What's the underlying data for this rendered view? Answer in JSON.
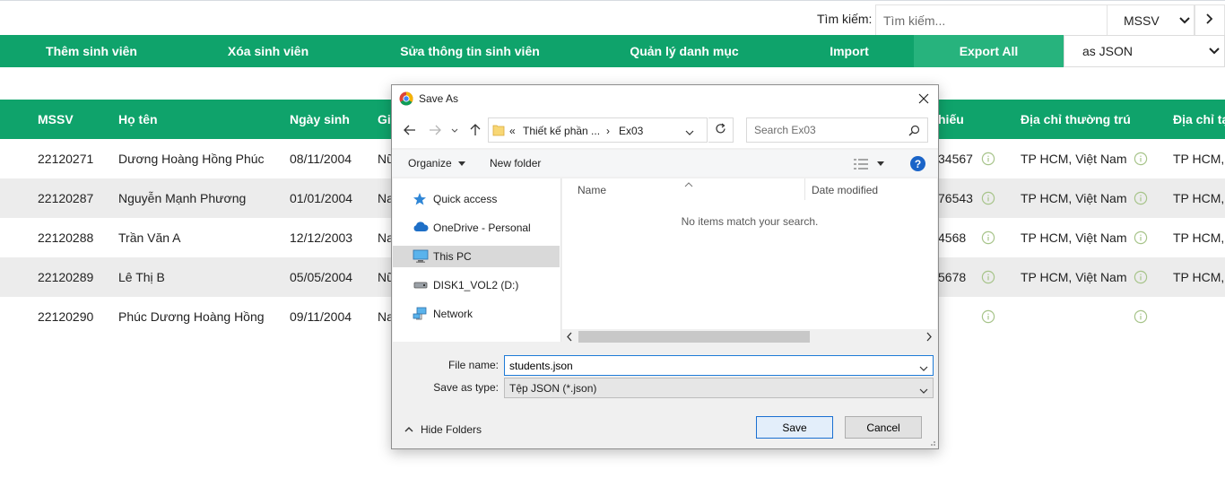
{
  "search": {
    "label": "Tìm kiếm:",
    "placeholder": "Tìm kiếm...",
    "field_value": "MSSV"
  },
  "menu": {
    "items": [
      "Thêm sinh viên",
      "Xóa sinh viên",
      "Sửa thông tin sinh viên",
      "Quản lý danh mục",
      "Import"
    ],
    "export_label": "Export All",
    "export_format": "as JSON"
  },
  "table": {
    "headers": {
      "mssv": "MSSV",
      "hoten": "Họ tên",
      "ngaysinh": "Ngày sinh",
      "gioitinh_partial": "Gi",
      "phone_partial": "hiếu",
      "diachi_thuongtru": "Địa chỉ thường trú",
      "diachi_tamtru_partial": "Địa chỉ tạ"
    },
    "rows": [
      {
        "mssv": "22120271",
        "hoten": "Dương Hoàng Hồng Phúc",
        "ngaysinh": "08/11/2004",
        "gt": "Nữ",
        "phone": "34567",
        "thuongtru": "TP HCM, Việt Nam",
        "tamtru": "TP HCM,"
      },
      {
        "mssv": "22120287",
        "hoten": "Nguyễn Mạnh Phương",
        "ngaysinh": "01/01/2004",
        "gt": "Na",
        "phone": "76543",
        "thuongtru": "TP HCM, Việt Nam",
        "tamtru": "TP HCM,"
      },
      {
        "mssv": "22120288",
        "hoten": "Trần Văn A",
        "ngaysinh": "12/12/2003",
        "gt": "Na",
        "phone": "4568",
        "thuongtru": "TP HCM, Việt Nam",
        "tamtru": "TP HCM,"
      },
      {
        "mssv": "22120289",
        "hoten": "Lê Thị B",
        "ngaysinh": "05/05/2004",
        "gt": "Nữ",
        "phone": "5678",
        "thuongtru": "TP HCM, Việt Nam",
        "tamtru": "TP HCM,"
      },
      {
        "mssv": "22120290",
        "hoten": "Phúc Dương Hoàng Hồng",
        "ngaysinh": "09/11/2004",
        "gt": "Na",
        "phone": "",
        "thuongtru": "",
        "tamtru": ""
      }
    ]
  },
  "dialog": {
    "title": "Save As",
    "address_prefix": "«",
    "address_path": "Thiết kế phần ...",
    "address_sep": "›",
    "address_current": "Ex03",
    "search_placeholder": "Search Ex03",
    "organize": "Organize",
    "new_folder": "New folder",
    "nav_items": [
      {
        "label": "Quick access",
        "icon": "star-icon"
      },
      {
        "label": "OneDrive - Personal",
        "icon": "cloud-icon"
      },
      {
        "label": "This PC",
        "icon": "computer-icon"
      },
      {
        "label": "DISK1_VOL2 (D:)",
        "icon": "drive-icon"
      },
      {
        "label": "Network",
        "icon": "network-icon"
      }
    ],
    "col_name": "Name",
    "col_date": "Date modified",
    "empty": "No items match your search.",
    "file_name_label": "File name:",
    "file_name": "students.json",
    "save_type_label": "Save as type:",
    "save_type": "Tệp JSON (*.json)",
    "hide_folders": "Hide Folders",
    "save": "Save",
    "cancel": "Cancel"
  },
  "colors": {
    "brand_green": "#0fa36b",
    "export_green": "#27b37d",
    "row_alt": "#ececec",
    "info_icon": "#a7c48a"
  }
}
